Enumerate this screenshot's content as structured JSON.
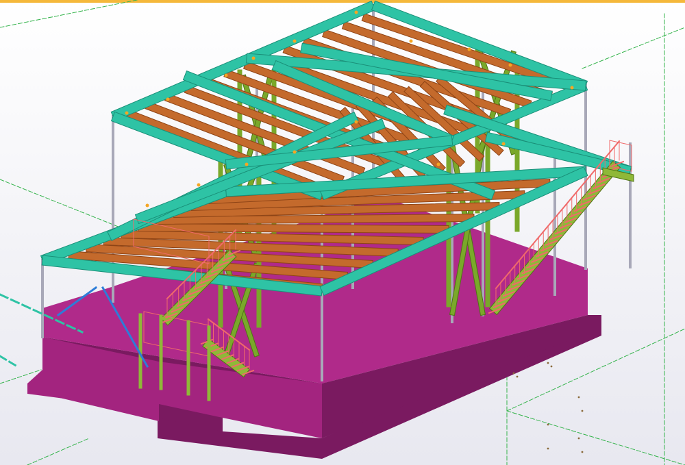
{
  "viewport": {
    "top_accent_color": "#f5b83b",
    "background_top": "#ffffff",
    "background_bottom": "#e8e8f0",
    "grid_line_color": "#33b34a"
  },
  "model": {
    "colors": {
      "foundation": "#a3247f",
      "foundation_dark": "#7a1a60",
      "foundation_top": "#b02a8a",
      "main_beam": "#2ec3a5",
      "main_beam_dark": "#1a8f78",
      "joist": "#c46a2c",
      "joist_dark": "#8e4416",
      "bracing": "#7aa82a",
      "bracing_dark": "#4f7316",
      "column": "#a8a8b8",
      "stair_rail": "#f06a6a",
      "stair_frame": "#8fb838",
      "tie_rod": "#2d7dd8",
      "connection": "#f5a623"
    },
    "icons": [
      "steel-column-icon",
      "main-beam-icon",
      "joist-icon",
      "bracing-icon",
      "stair-icon",
      "foundation-icon"
    ]
  }
}
